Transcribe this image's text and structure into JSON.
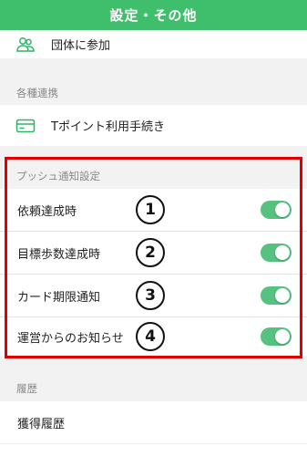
{
  "header": {
    "title": "設定・その他"
  },
  "rows": {
    "group_join": "団体に参加",
    "tpoint": "Tポイント利用手続き",
    "history_item": "獲得履歴"
  },
  "sections": {
    "integration": "各種連携",
    "push": "プッシュ通知設定",
    "history": "履歴"
  },
  "push_items": [
    {
      "label": "依頼達成時",
      "badge": "1",
      "enabled": true
    },
    {
      "label": "目標歩数達成時",
      "badge": "2",
      "enabled": true
    },
    {
      "label": "カード期限通知",
      "badge": "3",
      "enabled": true
    },
    {
      "label": "運営からのお知らせ",
      "badge": "4",
      "enabled": true
    }
  ],
  "colors": {
    "header": "#3fbe6c",
    "toggle_on": "#55c27f",
    "highlight": "#e00000",
    "icon": "#2bb463"
  }
}
